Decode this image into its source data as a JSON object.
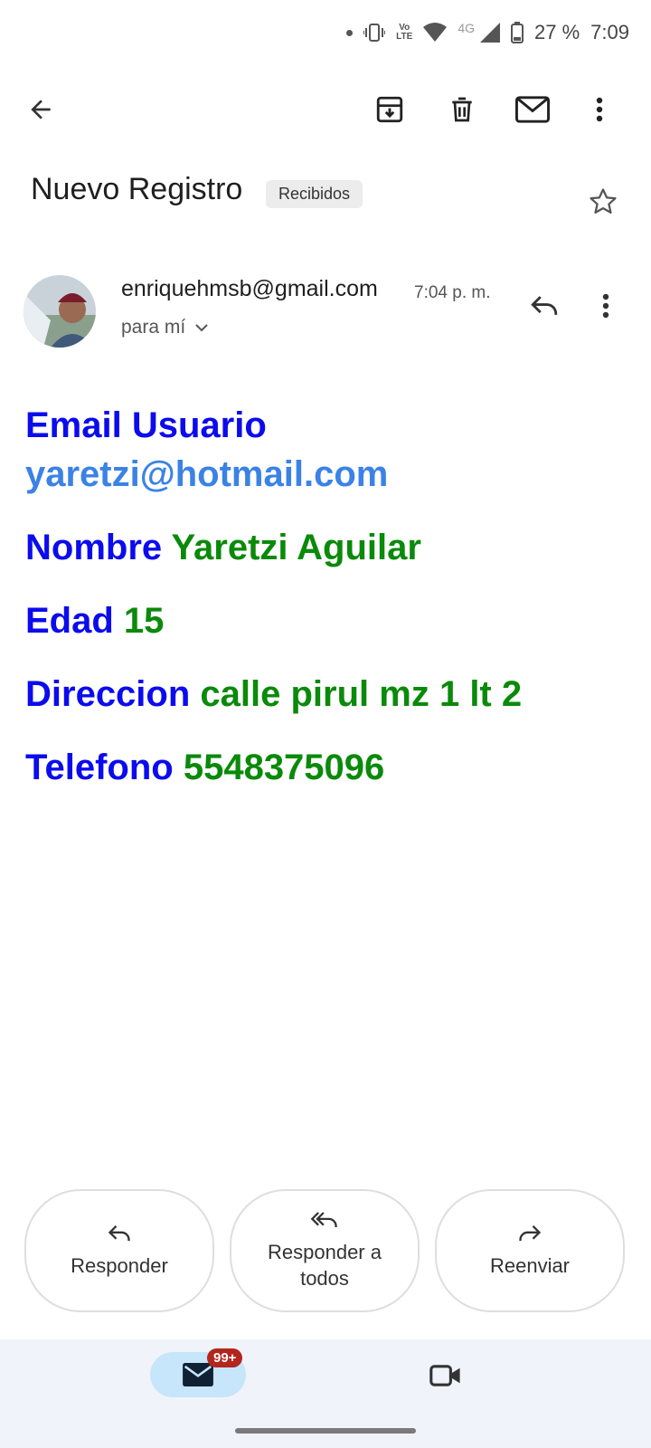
{
  "status_bar": {
    "battery": "27 %",
    "time": "7:09",
    "volte_top": "Vo",
    "volte_bottom": "LTE",
    "network": "4G"
  },
  "toolbar": {
    "back": "back-arrow-icon",
    "archive": "archive-icon",
    "delete": "trash-icon",
    "mark_unread": "mail-icon",
    "more": "more-vert-icon"
  },
  "email": {
    "subject": "Nuevo Registro",
    "label_chip": "Recibidos",
    "sender": "enriquehmsb@gmail.com",
    "time": "7:04 p. m.",
    "recipient": "para mí",
    "fields": {
      "email_label": "Email Usuario",
      "email_value": "yaretzi@hotmail.com",
      "name_label": "Nombre",
      "name_value": "Yaretzi Aguilar",
      "age_label": "Edad",
      "age_value": "15",
      "address_label": "Direccion",
      "address_value": "calle pirul mz 1 lt 2",
      "phone_label": "Telefono",
      "phone_value": "5548375096"
    }
  },
  "actions": {
    "reply": "Responder",
    "reply_all_line1": "Responder a",
    "reply_all_line2": "todos",
    "forward": "Reenviar"
  },
  "bottom_nav": {
    "mail_badge": "99+"
  },
  "colors": {
    "label_blue": "#0b0bee",
    "value_green": "#0a8a0a",
    "link_blue": "#3b82e6",
    "badge_red": "#b3261e",
    "nav_bg": "#f0f4fa"
  }
}
